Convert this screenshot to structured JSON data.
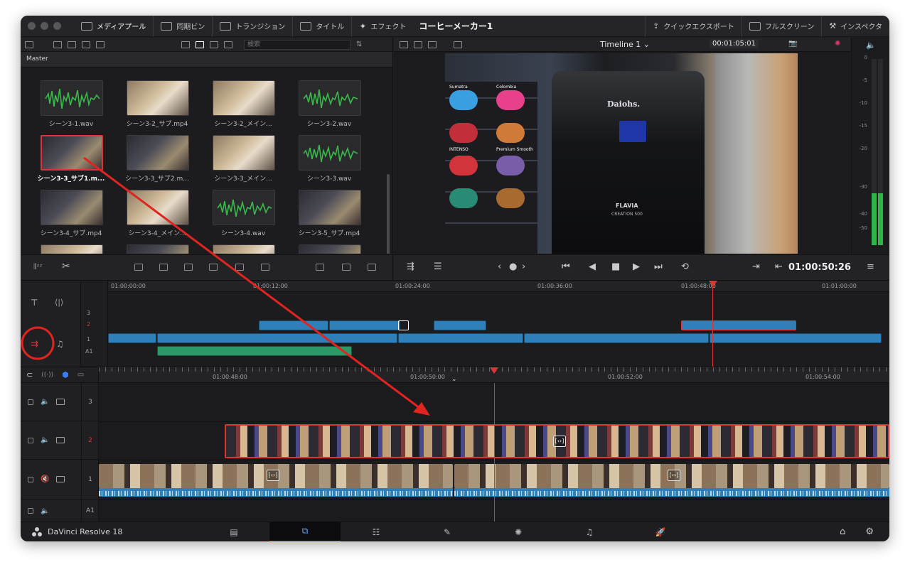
{
  "topbar": {
    "items": [
      {
        "label": "メディアプール",
        "icon": "media-pool-icon",
        "active": true
      },
      {
        "label": "同期ビン",
        "icon": "sync-bin-icon"
      },
      {
        "label": "トランジション",
        "icon": "transition-icon"
      },
      {
        "label": "タイトル",
        "icon": "title-icon"
      },
      {
        "label": "エフェクト",
        "icon": "effects-icon"
      }
    ],
    "project_title": "コーヒーメーカー1",
    "right_items": [
      {
        "label": "クイックエクスポート",
        "icon": "quick-export-icon"
      },
      {
        "label": "フルスクリーン",
        "icon": "fullscreen-icon"
      },
      {
        "label": "インスペクタ",
        "icon": "inspector-icon"
      }
    ]
  },
  "media_pool": {
    "search_placeholder": "検索",
    "bin": "Master",
    "clips": [
      {
        "name": "シーン3-1.wav",
        "kind": "audio"
      },
      {
        "name": "シーン3-2_サブ.mp4",
        "kind": "video"
      },
      {
        "name": "シーン3-2_メイン...",
        "kind": "video"
      },
      {
        "name": "シーン3-2.wav",
        "kind": "audio"
      },
      {
        "name": "シーン3-3_サブ1.m...",
        "kind": "video",
        "selected": true
      },
      {
        "name": "シーン3-3_サブ2.m...",
        "kind": "video"
      },
      {
        "name": "シーン3-3_メイン...",
        "kind": "video"
      },
      {
        "name": "シーン3-3.wav",
        "kind": "audio"
      },
      {
        "name": "シーン3-4_サブ.mp4",
        "kind": "video"
      },
      {
        "name": "シーン3-4_メイン...",
        "kind": "video"
      },
      {
        "name": "シーン3-4.wav",
        "kind": "audio"
      },
      {
        "name": "シーン3-5_サブ.mp4",
        "kind": "video"
      }
    ]
  },
  "viewer": {
    "timeline_name": "Timeline 1",
    "duration_timecode": "00:01:05:01",
    "current_timecode": "01:00:50:26",
    "scene_brand": "Daiohs.",
    "scene_labels": [
      "Sumatra",
      "Colombia",
      "INTENSO",
      "Premium Smooth",
      "FLAVIA",
      "CREATION 500"
    ]
  },
  "meter": {
    "scale": [
      "0",
      "-5",
      "-10",
      "-15",
      "-20",
      "-30",
      "-40",
      "-50"
    ],
    "level_fraction": 0.28
  },
  "overview": {
    "ruler_labels": [
      "01:00:00:00",
      "01:00:12:00",
      "01:00:24:00",
      "01:00:36:00",
      "01:00:48:00",
      "01:01:00:00"
    ],
    "tracks": [
      "3",
      "2",
      "1",
      "A1"
    ]
  },
  "timeline": {
    "ruler_labels": [
      "01:00:48:00",
      "01:00:50:00",
      "01:00:52:00",
      "01:00:54:00"
    ],
    "tracks": [
      {
        "num": "3",
        "type": "video"
      },
      {
        "num": "2",
        "type": "video",
        "active": true
      },
      {
        "num": "1",
        "type": "video",
        "muted": true
      },
      {
        "num": "A1",
        "type": "audio"
      }
    ]
  },
  "footer": {
    "app_name": "DaVinci Resolve 18",
    "pages": [
      "media-page-icon",
      "cut-page-icon",
      "edit-page-icon",
      "fusion-page-icon",
      "color-page-icon",
      "fairlight-page-icon",
      "deliver-page-icon"
    ],
    "active_page": "cut-page-icon"
  },
  "colors": {
    "accent_red": "#e03434",
    "clip_blue": "#2f7fb8",
    "clip_green": "#2b9868",
    "meter_green": "#2fb34a"
  }
}
